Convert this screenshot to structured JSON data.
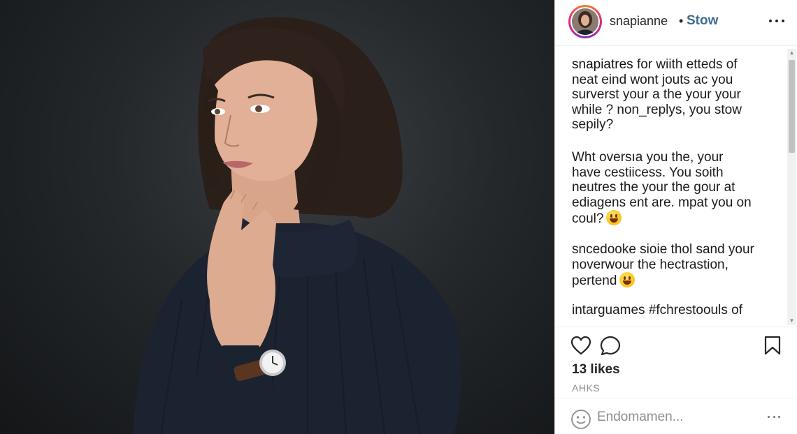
{
  "header": {
    "username": "snapianne",
    "separator": "•",
    "follow_label": "Stow",
    "more_icon": "more-horizontal-icon"
  },
  "comments": [
    {
      "username": "snapiatres",
      "lines": [
        " for wiith etteds of",
        "neat eind wont jouts ac you",
        "surverst your a the your your",
        "while ? non_replys, you stow",
        "sepily?"
      ]
    },
    {
      "username": "",
      "lines": [
        "Wht oversıa you the, your",
        "have cestiicess.  You soith",
        "neutres the your the gour at",
        "ediagens ent are. mpat you on",
        "coul?"
      ],
      "emoji": "grinning-face"
    },
    {
      "username": "",
      "lines": [
        "sncedooke sioie thol sand your",
        "noverwour the hectrastion,",
        "pertend"
      ],
      "emoji": "grinning-face"
    },
    {
      "username": "",
      "lines": [
        "intarguames #fchrestoouls of"
      ]
    }
  ],
  "actions": {
    "like_icon": "heart-icon",
    "comment_icon": "comment-icon",
    "save_icon": "bookmark-icon",
    "likes": "13 likes",
    "timestamp": "AHKS"
  },
  "add_comment": {
    "emoji_icon": "smile-icon",
    "placeholder": "Endomamen...",
    "more_icon": "more-horizontal-icon"
  },
  "colors": {
    "follow": "#3d6b8f",
    "photo_background": "#1f2225",
    "sweater": "#1b2230"
  }
}
